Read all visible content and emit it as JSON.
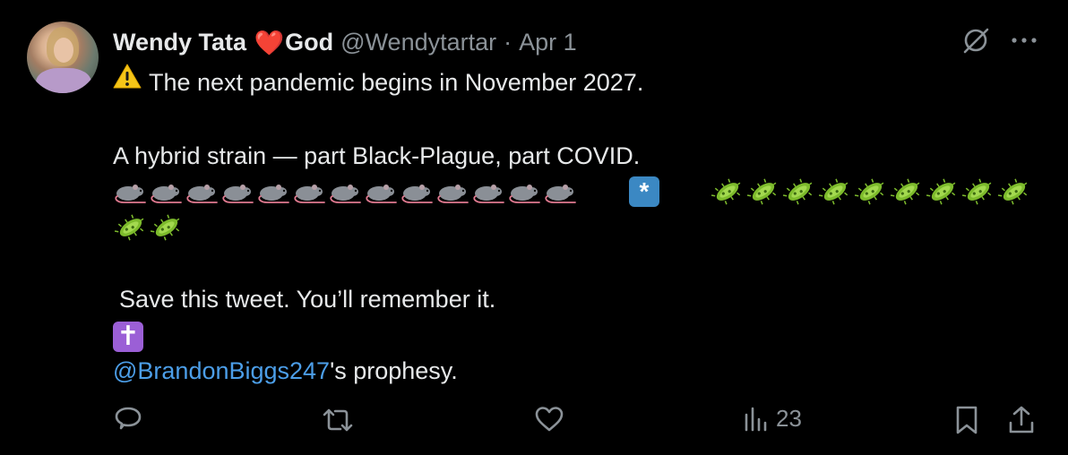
{
  "tweet": {
    "author": {
      "display_name_part1": "Wendy Tata ",
      "heart_emoji": "❤️",
      "display_name_part2": "God",
      "handle": "@Wendytartar",
      "separator": "·",
      "date": "Apr 1"
    },
    "text": {
      "line1": "The next pandemic begins in November 2027.",
      "line2": "A hybrid strain — part Black-Plague, part COVID.",
      "rat_count": 13,
      "asterisk_symbol": "*",
      "microbe_count_row1": 9,
      "microbe_count_row2": 2,
      "line3": "Save this tweet. You’ll remember it.",
      "cross_symbol": "✝",
      "mention": "@BrandonBiggs247",
      "mention_suffix": "'s prophesy."
    },
    "metrics": {
      "views": "23"
    }
  },
  "icons": {
    "warning": "warning-icon",
    "rat": "rat-icon",
    "microbe": "microbe-icon",
    "grok": "grok-icon",
    "more": "more-icon",
    "reply": "reply-icon",
    "retweet": "retweet-icon",
    "like": "like-icon",
    "views": "views-icon",
    "bookmark": "bookmark-icon",
    "share": "share-icon"
  },
  "colors": {
    "background": "#000000",
    "text": "#e7e9ea",
    "secondary": "#8b9298",
    "link": "#4c9ee8",
    "heart": "#e0245e",
    "asterisk_box": "#3b88c3",
    "cross_box": "#9b5fd6"
  }
}
